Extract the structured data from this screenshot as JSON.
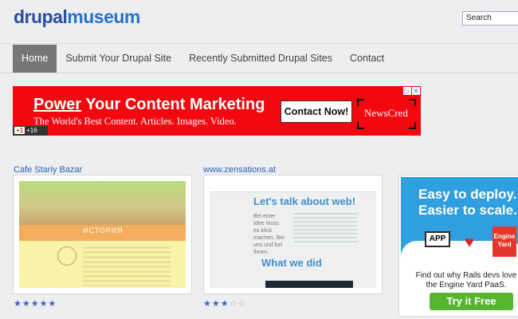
{
  "header": {
    "logo_part1": "drupal",
    "logo_part2": "museum",
    "search_value": "Search"
  },
  "nav": {
    "items": [
      "Home",
      "Submit Your Drupal Site",
      "Recently Submitted Drupal Sites",
      "Contact"
    ],
    "active_index": 0
  },
  "banner_ad": {
    "headline_highlight": "Power",
    "headline_rest": " Your Content Marketing",
    "subline": "The World's Best Content. Articles. Images. Video.",
    "cta": "Contact Now!",
    "brand": "NewsCred",
    "gplus_label": "+1",
    "gplus_count": "+16",
    "background": "#f2080e"
  },
  "sites": [
    {
      "title": "Cafe Stariy Bazar",
      "thumb_label": "ИСТОРИЯ",
      "rating": 5,
      "max_rating": 5
    },
    {
      "title": "www.zensations.at",
      "thumb_heading1": "Let's talk about web!",
      "thumb_body": "Bei einer Idee muss es klick machen. Bei uns und bei Ihnen.",
      "thumb_heading2": "What we did",
      "rating": 3,
      "max_rating": 5
    }
  ],
  "side_ad": {
    "headline_line1": "Easy to deploy.",
    "headline_line2": "Easier to scale.",
    "app_label": "APP",
    "brand_line1": "Engine",
    "brand_line2": "Yard",
    "text": "Find out why Rails devs love the Engine Yard PaaS.",
    "cta": "Try it Free",
    "accent": "#2f9fe0",
    "cta_color": "#55b52e"
  },
  "icons": {
    "star_full": "★",
    "star_empty": "☆",
    "ad_info": "▷",
    "ad_close": "✕",
    "heart": "♥"
  }
}
